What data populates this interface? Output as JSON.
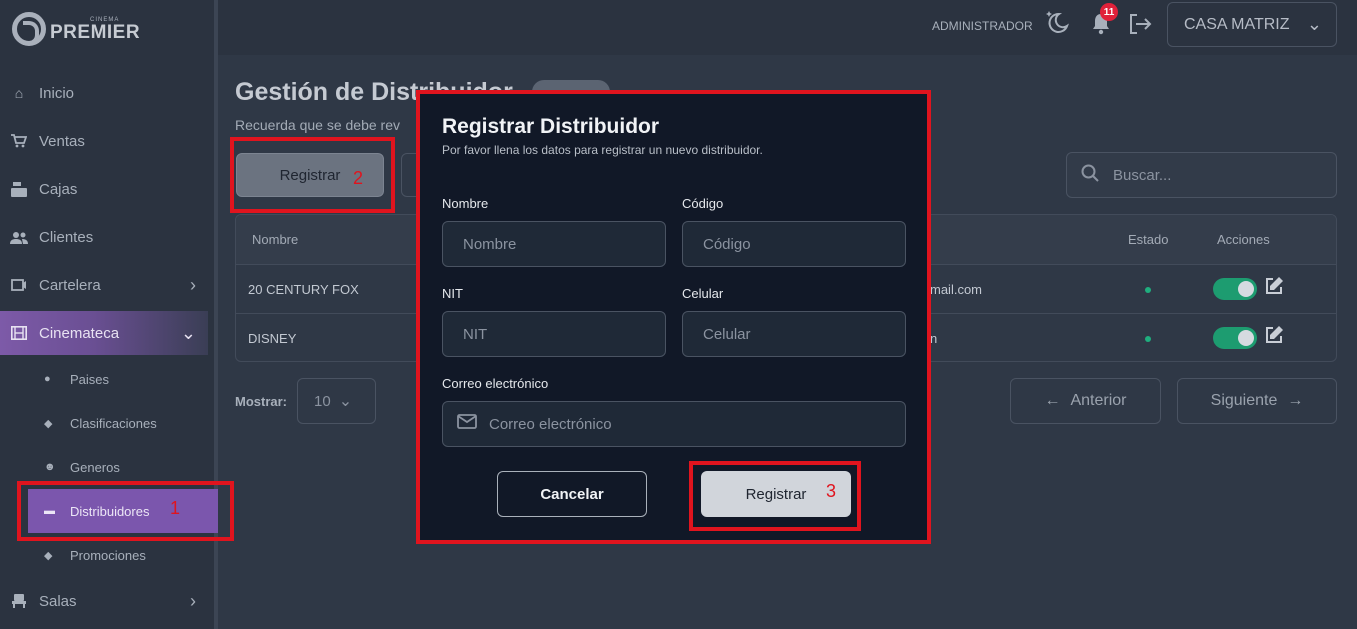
{
  "brand": {
    "small": "CINEMA",
    "name": "PREMIER"
  },
  "sidebar": {
    "items": [
      {
        "label": "Inicio",
        "icon": "home-icon"
      },
      {
        "label": "Ventas",
        "icon": "cart-icon"
      },
      {
        "label": "Cajas",
        "icon": "cash-register-icon"
      },
      {
        "label": "Clientes",
        "icon": "users-icon"
      },
      {
        "label": "Cartelera",
        "icon": "ticket-icon"
      },
      {
        "label": "Cinemateca",
        "icon": "film-icon"
      },
      {
        "label": "Salas",
        "icon": "seat-icon"
      }
    ],
    "subitems": [
      {
        "label": "Paises",
        "icon": "globe-icon"
      },
      {
        "label": "Clasificaciones",
        "icon": "tags-icon"
      },
      {
        "label": "Generos",
        "icon": "masks-icon"
      },
      {
        "label": "Distribuidores",
        "icon": "truck-icon"
      },
      {
        "label": "Promociones",
        "icon": "tag-icon"
      }
    ]
  },
  "topbar": {
    "user": "ADMINISTRADOR",
    "notifications": "11",
    "branch": "CASA MATRIZ"
  },
  "page": {
    "title": "Gestión de Distribuidor",
    "subtitle": "Recuerda que se debe rev",
    "register_label": "Registrar",
    "search_placeholder": "Buscar...",
    "show_label": "Mostrar:",
    "show_value": "10",
    "prev_label": "Anterior",
    "next_label": "Siguiente"
  },
  "table": {
    "columns": {
      "name": "Nombre",
      "status": "Estado",
      "actions": "Acciones"
    },
    "rows": [
      {
        "name": "20 CENTURY FOX",
        "email_tail": "mail.com",
        "active": true
      },
      {
        "name": "DISNEY",
        "email_tail": "n",
        "active": true
      }
    ]
  },
  "modal": {
    "title": "Registrar Distribuidor",
    "subtitle": "Por favor llena los datos para registrar un nuevo distribuidor.",
    "fields": {
      "nombre": {
        "label": "Nombre",
        "placeholder": "Nombre"
      },
      "codigo": {
        "label": "Código",
        "placeholder": "Código"
      },
      "nit": {
        "label": "NIT",
        "placeholder": "NIT"
      },
      "celular": {
        "label": "Celular",
        "placeholder": "Celular"
      },
      "correo": {
        "label": "Correo electrónico",
        "placeholder": "Correo electrónico"
      }
    },
    "cancel_label": "Cancelar",
    "register_label": "Registrar"
  },
  "annotations": {
    "step1": "1",
    "step2": "2",
    "step3": "3",
    "color": "#e0141e"
  }
}
